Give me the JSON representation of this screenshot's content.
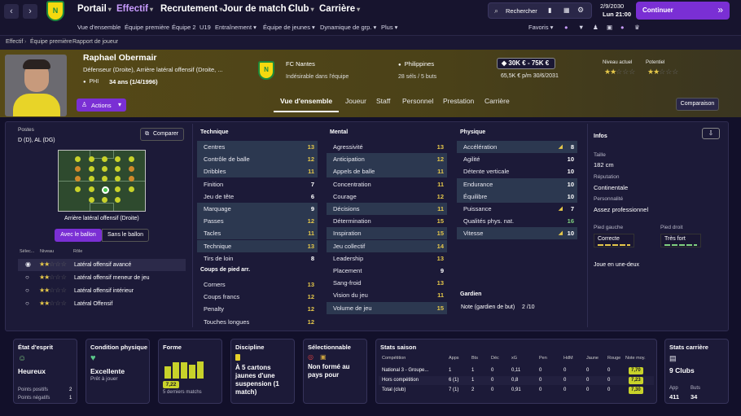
{
  "topnav": {
    "items": [
      "Portail",
      "Effectif",
      "Recrutement",
      "Jour de match",
      "Club",
      "Carrière"
    ],
    "search_label": "Rechercher",
    "date": "2/9/2030",
    "day_time": "Lun 21:00",
    "continue_label": "Continuer"
  },
  "subnav": {
    "items": [
      "Vue d'ensemble",
      "Équipe première",
      "Équipe 2",
      "U19",
      "Entraînement",
      "Équipe de jeunes",
      "Dynamique de grp.",
      "Plus"
    ],
    "favoris": "Favoris"
  },
  "breadcrumb": [
    "Effectif",
    "Équipe première",
    "Rapport de joueur"
  ],
  "player": {
    "name": "Raphael Obermair",
    "role": "Défenseur (Droite), Arrière latéral offensif (Droite, ...",
    "nationality_code": "PHI",
    "age": "34 ans (1/4/1996)",
    "actions_label": "Actions",
    "club": "FC Nantes",
    "club_status": "Indésirable dans l'équipe",
    "nation": "Philippines",
    "caps": "28 séls / 5 buts",
    "value": "30K € - 75K €",
    "wage": "65,5K € p/m 30/6/2031",
    "current_level_label": "Niveau actuel",
    "potential_label": "Potentiel"
  },
  "tabs": [
    "Vue d'ensemble",
    "Joueur",
    "Staff",
    "Personnel",
    "Prestation",
    "Carrière"
  ],
  "comparison_label": "Comparaison",
  "positions": {
    "title": "Postes",
    "value": "D (D), AL (DG)",
    "compare_label": "Comparer",
    "selected_role": "Arrière latéral offensif (Droite)",
    "with_ball": "Avec le ballon",
    "without_ball": "Sans le ballon",
    "col_select": "Sélec...",
    "col_level": "Niveau",
    "col_role": "Rôle",
    "roles": [
      "Latéral offensif avancé",
      "Latéral offensif meneur de jeu",
      "Latéral offensif intérieur",
      "Latéral Offensif"
    ]
  },
  "technique": {
    "title": "Technique",
    "rows": [
      [
        "Centres",
        "13"
      ],
      [
        "Contrôle de balle",
        "12"
      ],
      [
        "Dribbles",
        "11"
      ],
      [
        "Finition",
        "7"
      ],
      [
        "Jeu de tête",
        "6"
      ],
      [
        "Marquage",
        "9"
      ],
      [
        "Passes",
        "12"
      ],
      [
        "Tacles",
        "11"
      ],
      [
        "Technique",
        "13"
      ],
      [
        "Tirs de loin",
        "8"
      ]
    ]
  },
  "setpieces": {
    "title": "Coups de pied arr.",
    "rows": [
      [
        "Corners",
        "13"
      ],
      [
        "Coups francs",
        "12"
      ],
      [
        "Penalty",
        "12"
      ],
      [
        "Touches longues",
        "12"
      ]
    ]
  },
  "mental": {
    "title": "Mental",
    "rows": [
      [
        "Agressivité",
        "13"
      ],
      [
        "Anticipation",
        "12"
      ],
      [
        "Appels de balle",
        "11"
      ],
      [
        "Concentration",
        "11"
      ],
      [
        "Courage",
        "12"
      ],
      [
        "Décisions",
        "11"
      ],
      [
        "Détermination",
        "15"
      ],
      [
        "Inspiration",
        "15"
      ],
      [
        "Jeu collectif",
        "14"
      ],
      [
        "Leadership",
        "13"
      ],
      [
        "Placement",
        "9"
      ],
      [
        "Sang-froid",
        "13"
      ],
      [
        "Vision du jeu",
        "11"
      ],
      [
        "Volume de jeu",
        "15"
      ]
    ]
  },
  "physique": {
    "title": "Physique",
    "rows": [
      [
        "Accélération",
        "8"
      ],
      [
        "Agilité",
        "10"
      ],
      [
        "Détente verticale",
        "10"
      ],
      [
        "Endurance",
        "10"
      ],
      [
        "Équilibre",
        "10"
      ],
      [
        "Puissance",
        "7"
      ],
      [
        "Qualités phys. nat.",
        "16"
      ],
      [
        "Vitesse",
        "10"
      ]
    ]
  },
  "goalkeeper": {
    "title": "Gardien",
    "text": "Note (gardien de but)",
    "value": "2 /10"
  },
  "info": {
    "title": "Infos",
    "height_label": "Taille",
    "height": "182 cm",
    "rep_label": "Réputation",
    "rep": "Continentale",
    "pers_label": "Personnalité",
    "pers": "Assez professionnel",
    "left_foot_label": "Pied gauche",
    "left_foot": "Correcte",
    "right_foot_label": "Pied droit",
    "right_foot": "Très fort",
    "note": "Joue en une-deux"
  },
  "cards": {
    "morale": {
      "title": "État d'esprit",
      "value": "Heureux",
      "pos_label": "Points positifs",
      "pos": "2",
      "neg_label": "Points négatifs",
      "neg": "1"
    },
    "condition": {
      "title": "Condition physique",
      "value": "Excellente",
      "sub": "Prêt à jouer"
    },
    "form": {
      "title": "Forme",
      "avg": "7,22",
      "sub": "5 derniers matchs",
      "bars": [
        0.55,
        0.7,
        0.7,
        0.6,
        0.75
      ]
    },
    "discipline": {
      "title": "Discipline",
      "text": "À 5 cartons jaunes d'une suspension (1 match)"
    },
    "selectable": {
      "title": "Sélectionnable",
      "text": "Non formé au pays pour"
    },
    "season": {
      "title": "Stats saison",
      "cols": [
        "Compétition",
        "Apps",
        "Bts",
        "Déc",
        "xG",
        "Pen",
        "HdM",
        "Jaune",
        "Rouge",
        "Note moy."
      ],
      "rows": [
        [
          "National 3 - Groupe...",
          "1",
          "1",
          "0",
          "0,11",
          "0",
          "0",
          "0",
          "0",
          "7,70"
        ],
        [
          "Hors compétition",
          "6 (1)",
          "1",
          "0",
          "0,8",
          "0",
          "0",
          "0",
          "0",
          "7,23"
        ],
        [
          "Total (club)",
          "7 (1)",
          "2",
          "0",
          "0,91",
          "0",
          "0",
          "0",
          "0",
          "7,30"
        ]
      ]
    },
    "career": {
      "title": "Stats carrière",
      "clubs": "9 Clubs",
      "app_label": "App",
      "app": "411",
      "goals_label": "Buts",
      "goals": "34"
    }
  }
}
